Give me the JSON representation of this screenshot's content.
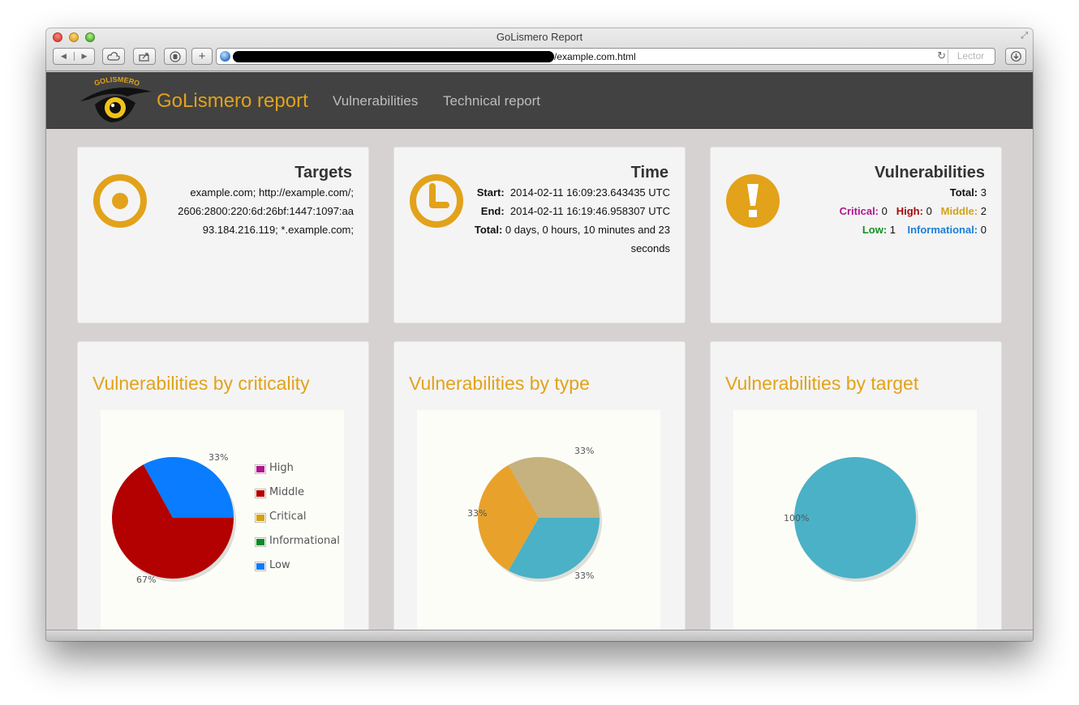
{
  "window": {
    "title": "GoLismero Report",
    "url_suffix": "/example.com.html",
    "reader_label": "Lector"
  },
  "navbar": {
    "logo_text": "GOLISMERO",
    "brand": "GoLismero report",
    "links": [
      "Vulnerabilities",
      "Technical report"
    ]
  },
  "summary": {
    "targets": {
      "title": "Targets",
      "lines": [
        "example.com; http://example.com/;",
        "2606:2800:220:6d:26bf:1447:1097:aa",
        "93.184.216.119; *.example.com;"
      ]
    },
    "time": {
      "title": "Time",
      "start_label": "Start:",
      "start": "2014-02-11 16:09:23.643435 UTC",
      "end_label": "End:",
      "end": "2014-02-11 16:19:46.958307 UTC",
      "total_label": "Total:",
      "total_line1": "0 days, 0 hours, 10 minutes and 23",
      "total_line2": "seconds"
    },
    "vulnerabilities": {
      "title": "Vulnerabilities",
      "total_label": "Total:",
      "total": "3",
      "critical_label": "Critical:",
      "critical": "0",
      "high_label": "High:",
      "high": "0",
      "middle_label": "Middle:",
      "middle": "2",
      "low_label": "Low:",
      "low": "1",
      "informational_label": "Informational:",
      "informational": "0"
    }
  },
  "colors": {
    "accent": "#e2a21a",
    "navbar": "#424242",
    "high": "#b0158e",
    "middle": "#b30000",
    "critical": "#d3a215",
    "informational": "#0a8a26",
    "low": "#0a7cff",
    "type_tan": "#c5b27f",
    "type_orange": "#e8a22b",
    "type_teal": "#4ab1c7"
  },
  "chart_data": [
    {
      "type": "pie",
      "title": "Vulnerabilities by criticality",
      "legend": [
        "High",
        "Middle",
        "Critical",
        "Informational",
        "Low"
      ],
      "legend_colors": [
        "#b0158e",
        "#b30000",
        "#d3a215",
        "#0a8a26",
        "#0a7cff"
      ],
      "slices": [
        {
          "name": "Middle",
          "value": 67,
          "color": "#b30000"
        },
        {
          "name": "Low",
          "value": 33,
          "color": "#0a7cff"
        }
      ],
      "labels": [
        "67%",
        "33%"
      ]
    },
    {
      "type": "pie",
      "title": "Vulnerabilities by type",
      "slices": [
        {
          "value": 33.3,
          "color": "#c5b27f"
        },
        {
          "value": 33.3,
          "color": "#4ab1c7"
        },
        {
          "value": 33.4,
          "color": "#e8a22b"
        }
      ],
      "labels": [
        "33%",
        "33%",
        "33%"
      ]
    },
    {
      "type": "pie",
      "title": "Vulnerabilities by target",
      "slices": [
        {
          "value": 100,
          "color": "#4ab1c7"
        }
      ],
      "labels": [
        "100%"
      ]
    }
  ]
}
